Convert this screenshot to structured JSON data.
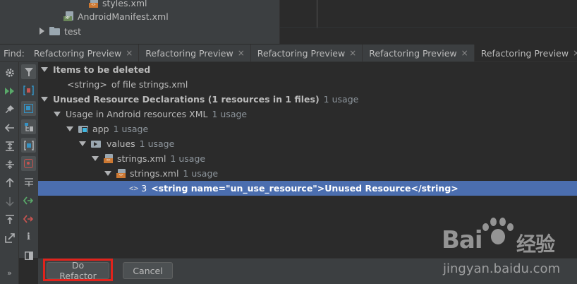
{
  "project_tree": {
    "styles_file": "styles.xml",
    "manifest_file": "AndroidManifest.xml",
    "test_folder": "test"
  },
  "find_bar": {
    "label": "Find:",
    "tabs": [
      {
        "label": "Refactoring Preview",
        "close": "×"
      },
      {
        "label": "Refactoring Preview",
        "close": "×"
      },
      {
        "label": "Refactoring Preview",
        "close": "×"
      },
      {
        "label": "Refactoring Preview",
        "close": "×"
      },
      {
        "label": "Refactoring Preview",
        "close": "×"
      }
    ],
    "active_tab_index": 4
  },
  "left_toolbar": {
    "icons": [
      "gear-icon",
      "rerun-icon",
      "pin-icon",
      "previous-icon",
      "expand-all-icon",
      "collapse-all-icon",
      "up-icon",
      "down-icon",
      "export-icon",
      "open-in-editor-icon"
    ],
    "overflow": "»"
  },
  "filter_toolbar": {
    "icons": [
      "filter-icon",
      "group-by-usage-type-icon",
      "group-by-module-icon",
      "group-by-package-icon",
      "group-by-file-structure-icon",
      "read-access-icon",
      "merge-icon",
      "include-icon",
      "exclude-icon",
      "info-icon",
      "preview-icon"
    ]
  },
  "tree": {
    "items_deleted": {
      "header": "Items to be deleted",
      "child_tag": "<string>",
      "child_rest": "of file strings.xml"
    },
    "unused": {
      "header": "Unused Resource Declarations (1 resources in 1 files)",
      "usage": "1 usage",
      "group": {
        "label": "Usage in Android resources XML",
        "usage": "1 usage"
      },
      "module": {
        "label": "app",
        "usage": "1 usage"
      },
      "folder": {
        "label": "values",
        "usage": "1 usage"
      },
      "file1": {
        "label": "strings.xml",
        "usage": "1 usage"
      },
      "file2": {
        "label": "strings.xml",
        "usage": "1 usage"
      },
      "reference": {
        "icon": "<>",
        "line": "3",
        "code": "<string name=\"un_use_resource\">Unused Resource</string>"
      }
    }
  },
  "buttons": {
    "do_refactor": "Do Refactor",
    "cancel": "Cancel"
  },
  "colors": {
    "background": "#2b2b2b",
    "panel": "#3c3f41",
    "selection": "#4b6eaf",
    "highlight_border": "#e0231c"
  },
  "watermark": {
    "brand_left": "Bai",
    "brand_right": "经验",
    "url": "jingyan.baidu.com"
  }
}
